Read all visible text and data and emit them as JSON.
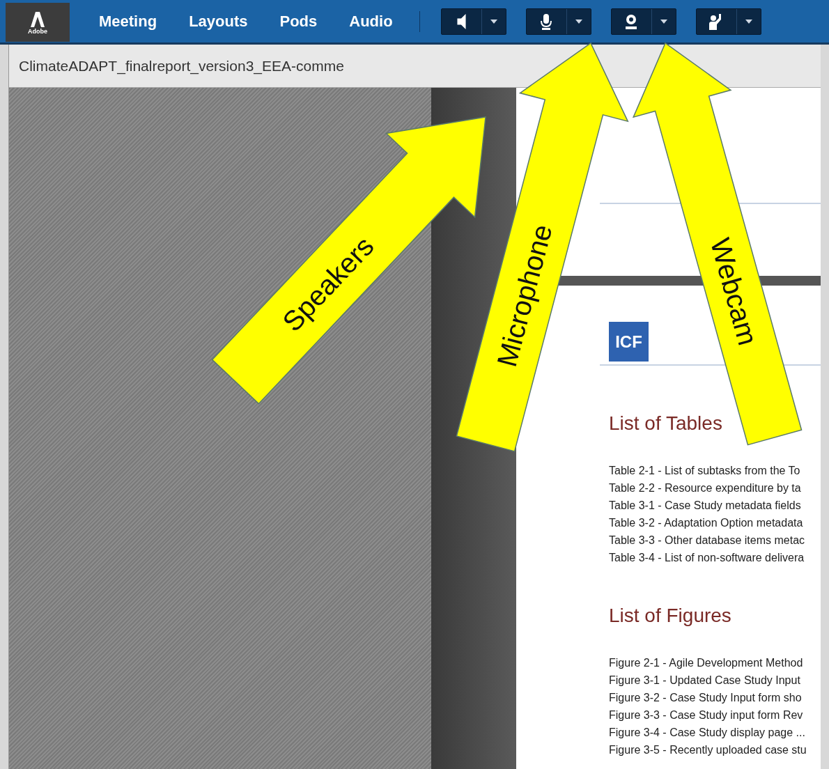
{
  "menu": {
    "logo_text": "Adobe",
    "items": [
      "Meeting",
      "Layouts",
      "Pods",
      "Audio"
    ]
  },
  "toolbar": [
    {
      "kind": "speaker"
    },
    {
      "kind": "microphone"
    },
    {
      "kind": "webcam"
    },
    {
      "kind": "raise-hand"
    }
  ],
  "document": {
    "title": "ClimateADAPT_finalreport_version3_EEA-comme",
    "logo": "ICF",
    "sections": [
      {
        "heading": "List of Tables",
        "entries": [
          "Table 2-1 - List of subtasks from the To",
          "Table 2-2 - Resource expenditure by ta",
          "Table 3-1 - Case Study metadata fields",
          "Table 3-2 - Adaptation Option metadata",
          "Table 3-3 - Other database items metac",
          "Table 3-4 - List of non-software delivera"
        ]
      },
      {
        "heading": "List of Figures",
        "entries": [
          "Figure 2-1 - Agile Development Method",
          "Figure 3-1 - Updated Case Study Input",
          "Figure 3-2 - Case Study Input form sho",
          "Figure 3-3 - Case Study input form Rev",
          "Figure 3-4 - Case Study display page ...",
          "Figure 3-5 - Recently uploaded case stu"
        ]
      }
    ]
  },
  "annotations": [
    {
      "label": "Speakers"
    },
    {
      "label": "Microphone"
    },
    {
      "label": "Webcam"
    }
  ]
}
